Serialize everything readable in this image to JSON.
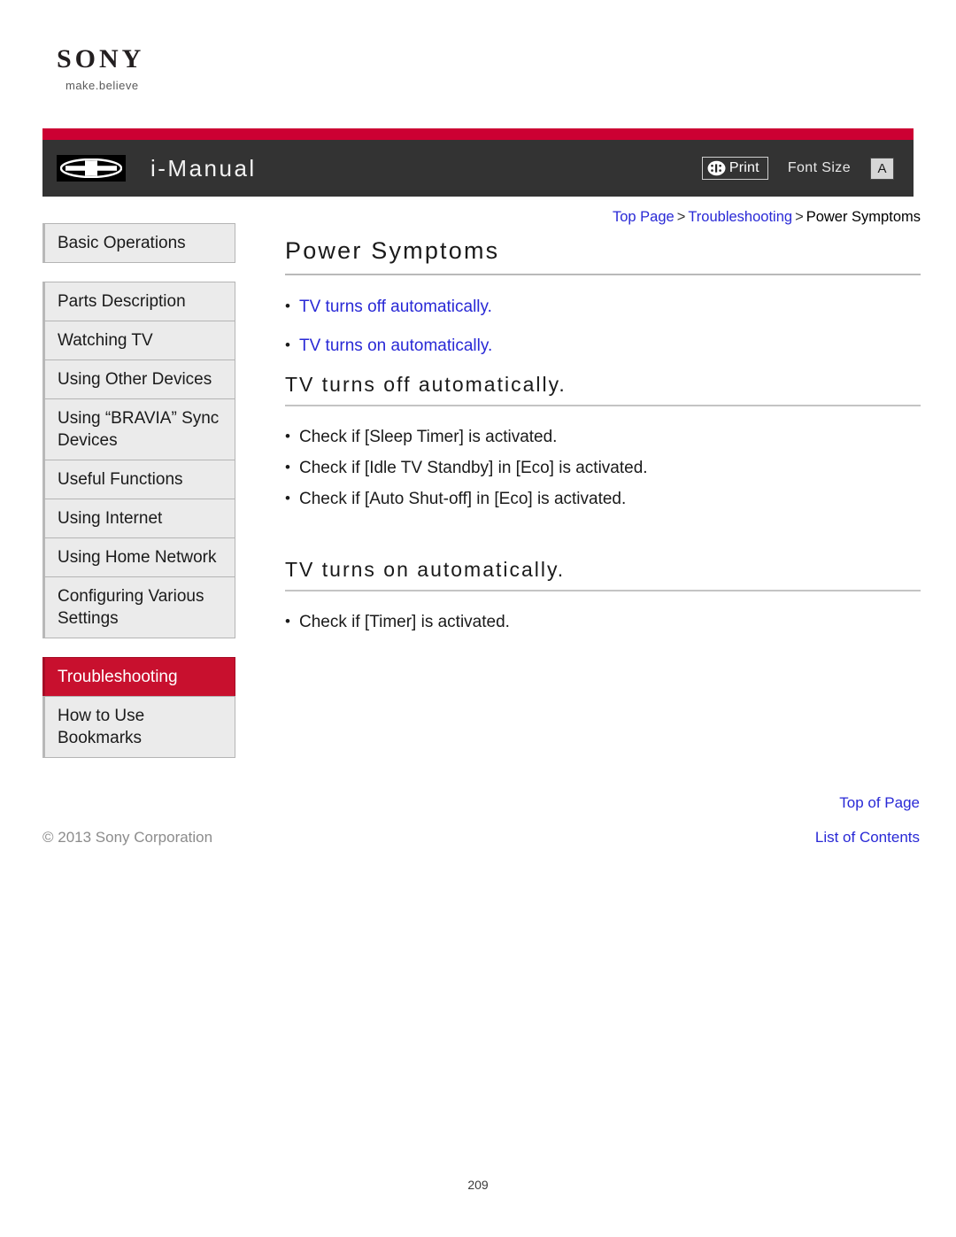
{
  "brand": {
    "name": "SONY",
    "tagline": "make.believe"
  },
  "header": {
    "title": "i-Manual",
    "manual_icon": "imanual-book-icon",
    "print_label": "Print",
    "print_icon": "print-icon",
    "font_size_label": "Font Size",
    "font_size_value": "A",
    "stripe_color": "#cc0033",
    "bar_color": "#333333"
  },
  "breadcrumb": {
    "items": [
      {
        "label": "Top Page",
        "link": true
      },
      {
        "label": "Troubleshooting",
        "link": true
      },
      {
        "label": "Power Symptoms",
        "link": false
      }
    ],
    "separator": ">"
  },
  "sidebar": {
    "items": [
      {
        "label": "Basic Operations",
        "active": false
      },
      {
        "label": "Parts Description",
        "active": false
      },
      {
        "label": "Watching TV",
        "active": false
      },
      {
        "label": "Using Other Devices",
        "active": false
      },
      {
        "label": "Using “BRAVIA” Sync Devices",
        "active": false
      },
      {
        "label": "Useful Functions",
        "active": false
      },
      {
        "label": "Using Internet",
        "active": false
      },
      {
        "label": "Using Home Network",
        "active": false
      },
      {
        "label": "Configuring Various Settings",
        "active": false
      },
      {
        "label": "Troubleshooting",
        "active": true
      },
      {
        "label": "How to Use Bookmarks",
        "active": false
      }
    ],
    "active_color": "#c8102e",
    "item_bg": "#ebebeb"
  },
  "main": {
    "page_title": "Power Symptoms",
    "quick_links": [
      {
        "label": "TV turns off automatically."
      },
      {
        "label": "TV turns on automatically."
      }
    ],
    "sections": [
      {
        "title": "TV turns off automatically.",
        "bullets": [
          "Check if [Sleep Timer] is activated.",
          "Check if [Idle TV Standby] in [Eco] is activated.",
          "Check if [Auto Shut-off] in [Eco] is activated."
        ]
      },
      {
        "title": "TV turns on automatically.",
        "bullets": [
          "Check if [Timer] is activated."
        ]
      }
    ]
  },
  "footer": {
    "top_of_page": "Top of Page",
    "copyright": "© 2013 Sony Corporation",
    "list_of_contents": "List of Contents",
    "page_number": "209",
    "link_color": "#2929d6"
  }
}
